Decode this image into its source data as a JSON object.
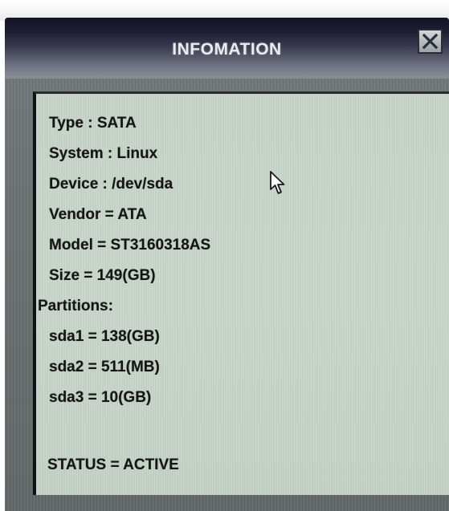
{
  "dialog": {
    "title": "INFOMATION",
    "close_icon": "close-x-icon"
  },
  "info": {
    "type": "Type : SATA",
    "system": "System : Linux",
    "device": "Device : /dev/sda",
    "vendor": "Vendor = ATA",
    "model": "Model = ST3160318AS",
    "size": "Size = 149(GB)",
    "partitions_label": "Partitions:",
    "partitions": [
      "sda1 = 138(GB)",
      "sda2 = 511(MB)",
      "sda3 = 10(GB)"
    ],
    "status": "STATUS = ACTIVE"
  },
  "cursor": {
    "icon": "mouse-pointer-icon"
  },
  "colors": {
    "titlebar_dark": "#1d1c33",
    "panel_bg": "#c9d6cb",
    "text": "#141414",
    "dialog_body": "#6c7273"
  }
}
